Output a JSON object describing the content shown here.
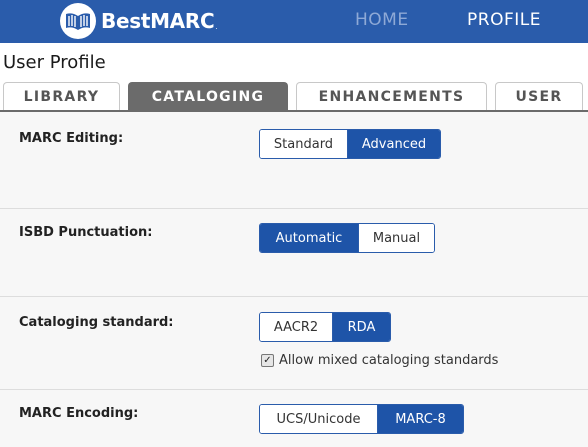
{
  "header": {
    "brand": "BestMARC",
    "trademark": ".",
    "nav_home": "HOME",
    "nav_profile": "PROFILE",
    "bar_color": "#2a5cab"
  },
  "page": {
    "title": "User Profile"
  },
  "tabs": [
    {
      "label": "LIBRARY",
      "active": false
    },
    {
      "label": "CATALOGING",
      "active": true
    },
    {
      "label": "ENHANCEMENTS",
      "active": false
    },
    {
      "label": "USER",
      "active": false
    }
  ],
  "settings": {
    "marc_editing": {
      "label": "MARC Editing:",
      "options": [
        "Standard",
        "Advanced"
      ],
      "selected": "Advanced"
    },
    "isbd_punctuation": {
      "label": "ISBD Punctuation:",
      "options": [
        "Automatic",
        "Manual"
      ],
      "selected": "Automatic"
    },
    "cataloging_standard": {
      "label": "Cataloging standard:",
      "options": [
        "AACR2",
        "RDA"
      ],
      "selected": "RDA",
      "allow_mixed_label": "Allow mixed cataloging standards",
      "allow_mixed_checked": true
    },
    "marc_encoding": {
      "label": "MARC Encoding:",
      "options": [
        "UCS/Unicode",
        "MARC-8"
      ],
      "selected": "MARC-8"
    }
  },
  "colors": {
    "selected_segment": "#1e54a8",
    "active_tab": "#6b6b6b"
  }
}
